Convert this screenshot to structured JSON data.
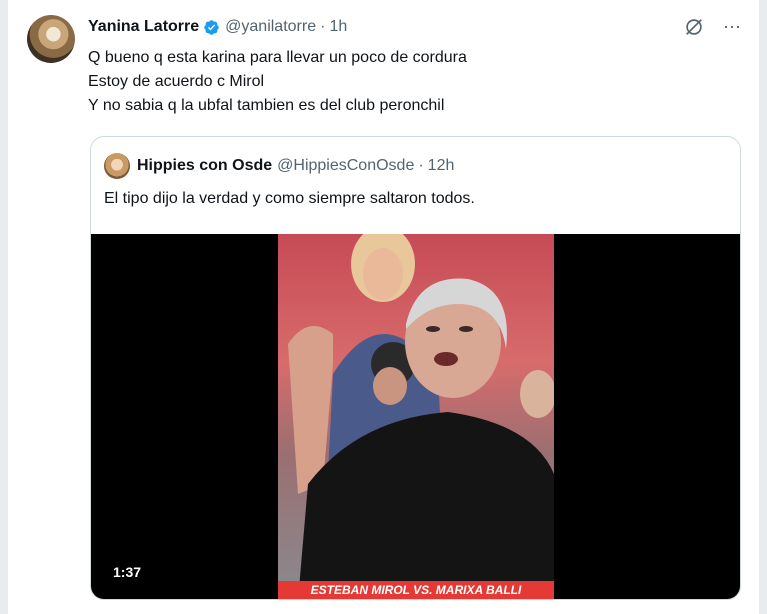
{
  "tweet": {
    "author_name": "Yanina Latorre",
    "author_handle": "@yanilatorre",
    "separator": "·",
    "time": "1h",
    "lines": [
      "Q bueno q esta karina para llevar un poco de cordura",
      "Estoy de acuerdo c Mirol",
      "Y no sabia q la ubfal tambien es del club peronchil"
    ],
    "icons": {
      "grok": "grok-icon",
      "more": "more-icon"
    }
  },
  "quote": {
    "author_name": "Hippies con Osde",
    "author_handle": "@HippiesConOsde",
    "separator": "·",
    "time": "12h",
    "text": "El tipo dijo la verdad y como siempre saltaron todos.",
    "video": {
      "duration": "1:37",
      "caption": "ESTEBAN MIROL VS. MARIXA BALLI"
    }
  },
  "colors": {
    "verified": "#1d9bf0",
    "caption_bar": "#e53935"
  }
}
